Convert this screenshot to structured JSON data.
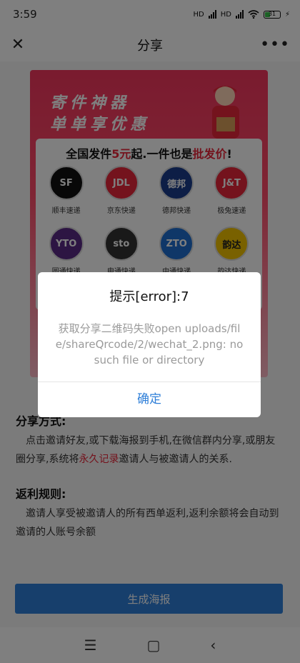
{
  "status_bar": {
    "time": "3:59",
    "battery": "31",
    "net1": "HD",
    "net2": "HD"
  },
  "nav": {
    "title": "分享",
    "close_icon": "close-icon",
    "more_icon": "more-icon"
  },
  "poster": {
    "slogan_line1": "寄件神器",
    "slogan_line2": "单单享优惠",
    "headline_pre": "全国发件",
    "headline_highlight": "5元",
    "headline_mid": "起.一件也是",
    "headline_highlight2": "批发价",
    "headline_end": "!",
    "couriers": [
      {
        "name": "顺丰速递",
        "mark": "SF",
        "color": "#111111"
      },
      {
        "name": "京东快递",
        "mark": "JDL",
        "color": "#e8263a"
      },
      {
        "name": "德邦快递",
        "mark": "德邦",
        "color": "#1a3c8c"
      },
      {
        "name": "极兔速递",
        "mark": "J&T",
        "color": "#e8263a"
      },
      {
        "name": "圆通快递",
        "mark": "YTO",
        "color": "#5b2a86"
      },
      {
        "name": "申通快递",
        "mark": "sto",
        "color": "#333333"
      },
      {
        "name": "中通快递",
        "mark": "ZTO",
        "color": "#1f6fd1"
      },
      {
        "name": "韵达快递",
        "mark": "韵达",
        "color": "#f2c200"
      }
    ]
  },
  "info": {
    "share_title": "分享方式:",
    "share_pre": "点击邀请好友,或下载海报到手机,在微信群内分享,或朋友圈分享,系统将",
    "share_highlight": "永久记录",
    "share_post": "邀请人与被邀请人的关系.",
    "rules_title": "返利规则:",
    "rules_text": "邀请人享受被邀请人的所有西单返利,返利余额将会自动到邀请的人账号余额"
  },
  "generate_button": "生成海报",
  "dialog": {
    "title": "提示[error]:7",
    "message": "获取分享二维码失败open uploads/file/shareQrcode/2/wechat_2.png: no such file or directory",
    "confirm": "确定"
  },
  "system_nav": {
    "menu": "☰",
    "home": "▢",
    "back": "‹"
  }
}
